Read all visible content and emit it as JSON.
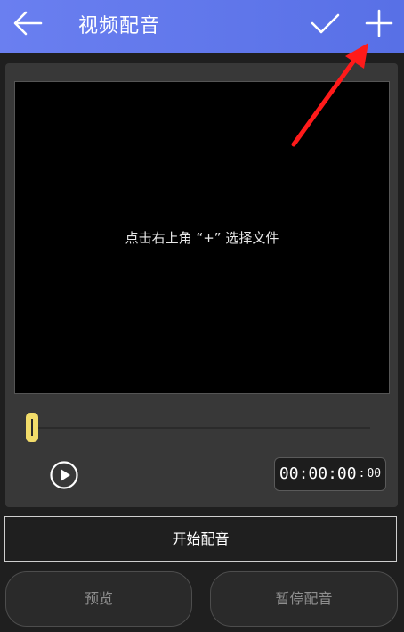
{
  "header": {
    "title": "视频配音",
    "back_icon": "arrow-left-icon",
    "confirm_icon": "checkmark-icon",
    "add_icon": "plus-icon",
    "background_color": "#5f76ea"
  },
  "preview": {
    "hint": "点击右上角 “+” 选择文件"
  },
  "timeline": {
    "handle_color": "#f2dc6a",
    "progress_fraction": 0
  },
  "playback": {
    "play_icon": "play-icon",
    "time_main": "00:00:00",
    "time_ms_sep": ":",
    "time_ms": "00"
  },
  "actions": {
    "start_label": "开始配音",
    "preview_label": "预览",
    "pause_label": "暂停配音"
  },
  "annotation": {
    "arrow_color": "#ff1a1a"
  }
}
